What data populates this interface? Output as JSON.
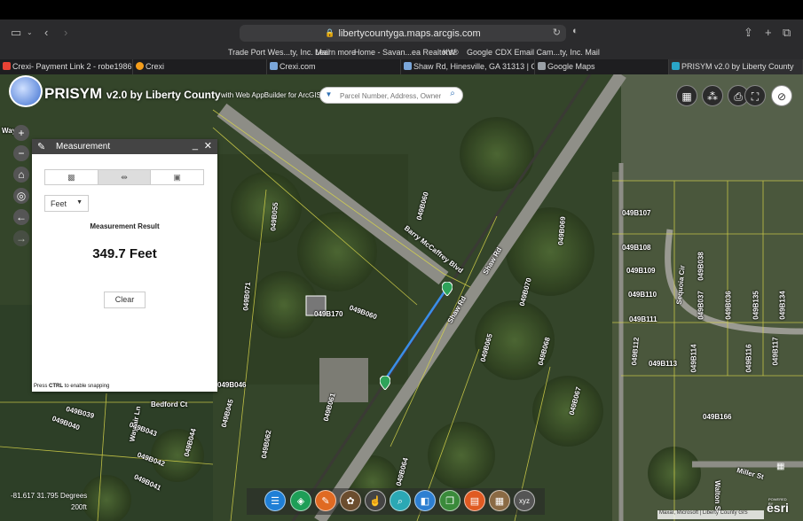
{
  "browser": {
    "url": "libertycountyga.maps.arcgis.com",
    "bookmarks": [
      "Trade Port Wes...ty, Inc. Mail",
      "Learn more",
      "Home - Savan...ea Realtors®",
      "KW",
      "Google",
      "CDX Email Cam...ty, Inc. Mail"
    ],
    "tabs": [
      {
        "label": "Crexi- Payment Link 2 - robe1986...",
        "color": "#e94335"
      },
      {
        "label": "Crexi",
        "color": "#f59e1b"
      },
      {
        "label": "Crexi.com",
        "color": "#7aa6d9"
      },
      {
        "label": "Shaw Rd, Hinesville, GA 31313 | C...",
        "color": "#7aa6d9"
      },
      {
        "label": "Google Maps",
        "color": "#9aa0a6"
      },
      {
        "label": "PRISYM v2.0 by Liberty County",
        "color": "#2aa6c8"
      }
    ]
  },
  "app": {
    "title": "PRISYM",
    "version": "v2.0 by Liberty County",
    "subtitle": "with Web AppBuilder for ArcGIS",
    "search_placeholder": "Parcel Number, Address, Owner"
  },
  "measurement": {
    "title": "Measurement",
    "unit": "Feet",
    "result_label": "Measurement Result",
    "result_value": "349.7 Feet",
    "clear_label": "Clear",
    "snap_prefix": "Press ",
    "snap_key": "CTRL",
    "snap_suffix": " to enable snapping"
  },
  "map": {
    "coordinates": "-81.617 31.795 Degrees",
    "scale": "200ft",
    "attribution": "Maxar, Microsoft | Liberty County GIS",
    "esri_powered": "POWERED BY",
    "esri": "esri",
    "road_labels": [
      "Barry McCaffrey Blvd",
      "Shaw Rd",
      "Shaw Rd",
      "Bedford Ct",
      "Wayfair Ln",
      "Sequoia Cir",
      "Miller St",
      "Walton St",
      "Way"
    ],
    "parcel_labels": [
      "049B060",
      "049B055",
      "049B071",
      "049B170",
      "049B060",
      "049B070",
      "049B069",
      "049B068",
      "049B067",
      "049B065",
      "049B064",
      "049B061",
      "049B062",
      "049B045",
      "049B046",
      "049B044",
      "049B043",
      "049B042",
      "049B041",
      "049B039",
      "049B040",
      "049B107",
      "049B108",
      "049B109",
      "049B110",
      "049B111",
      "049B112",
      "049B113",
      "049B166",
      "049B038",
      "049B037",
      "049B036",
      "049B135",
      "049B134",
      "049B114",
      "049B116",
      "049B117"
    ]
  }
}
